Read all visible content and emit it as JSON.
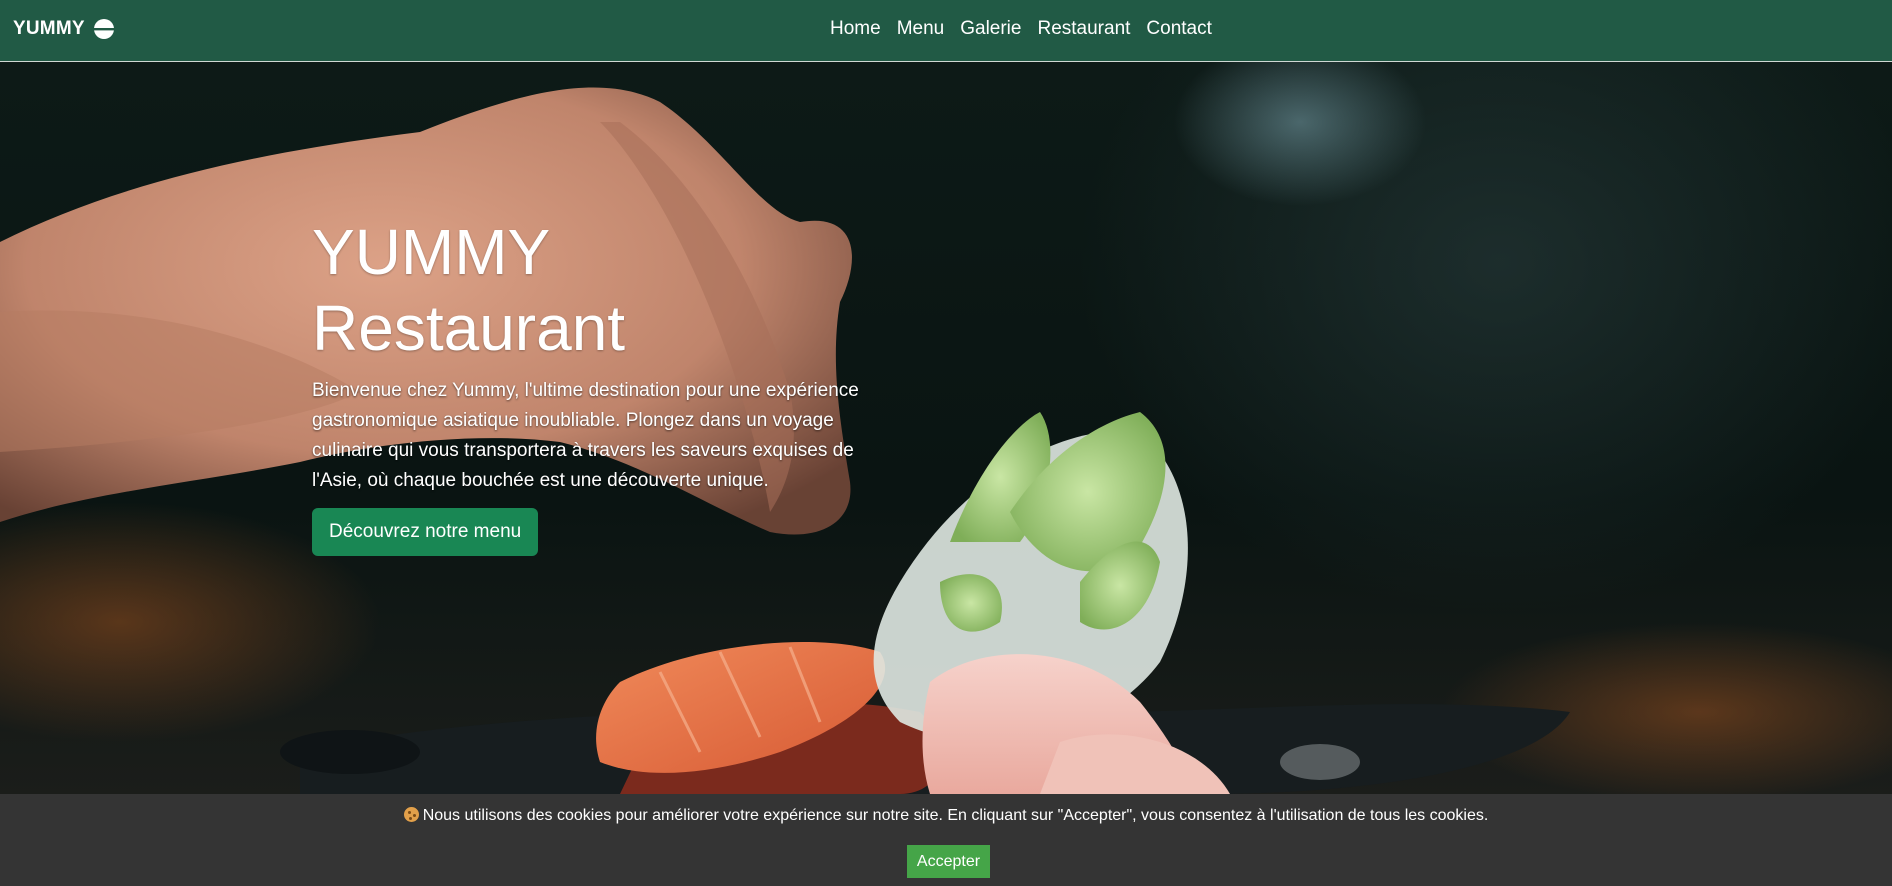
{
  "navbar": {
    "brand": "YUMMY",
    "brand_icon": "bowl-icon",
    "links": [
      "Home",
      "Menu",
      "Galerie",
      "Restaurant",
      "Contact"
    ]
  },
  "hero": {
    "title_line1": "YUMMY",
    "title_line2": "Restaurant",
    "description": "Bienvenue chez Yummy, l'ultime destination pour une expérience gastronomique asiatique inoubliable. Plongez dans un voyage culinaire qui vous transportera à travers les saveurs exquises de l'Asie, où chaque bouchée est une découverte unique.",
    "cta_label": "Découvrez notre menu"
  },
  "cookie_banner": {
    "icon": "cookie-icon",
    "text": "Nous utilisons des cookies pour améliorer votre expérience sur notre site. En cliquant sur \"Accepter\", vous consentez à l'utilisation de tous les cookies.",
    "accept_label": "Accepter"
  },
  "colors": {
    "navbar_bg": "#215a45",
    "cta_bg": "#198754",
    "cookie_bg": "#343434",
    "accept_bg": "#45a548"
  }
}
